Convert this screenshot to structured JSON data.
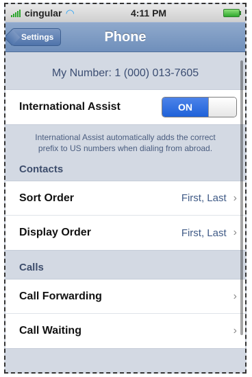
{
  "status": {
    "carrier": "cingular",
    "time": "4:11 PM",
    "icons": [
      "signal-icon",
      "wifi-icon",
      "battery-icon"
    ],
    "accent": "#2aa52a"
  },
  "nav": {
    "back_label": "Settings",
    "title": "Phone"
  },
  "my_number": "My Number: 1 (000) 013-7605",
  "international": {
    "label": "International Assist",
    "toggle_value": "ON",
    "note": "International Assist automatically adds the correct prefix to US numbers when dialing from abroad."
  },
  "contacts": {
    "header": "Contacts",
    "items": [
      {
        "label": "Sort Order",
        "value": "First, Last"
      },
      {
        "label": "Display Order",
        "value": "First, Last"
      }
    ]
  },
  "calls": {
    "header": "Calls",
    "items": [
      {
        "label": "Call Forwarding"
      },
      {
        "label": "Call Waiting"
      }
    ]
  },
  "chevron": "›",
  "colors": {
    "nav": "#6f8fbb",
    "toggle_on": "#1f62d9",
    "background": "#d3d9e3"
  }
}
